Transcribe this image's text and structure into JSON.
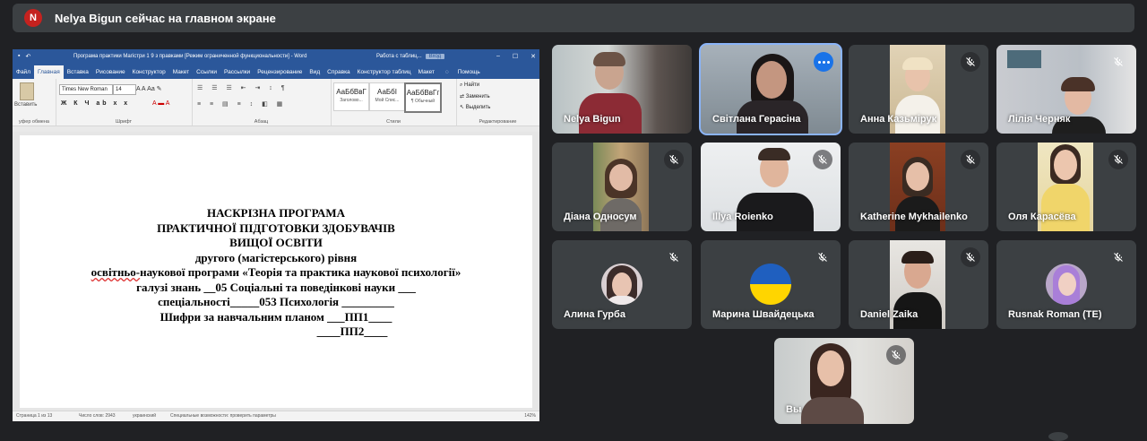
{
  "presenter_bar": {
    "avatar_letter": "N",
    "text": "Nelya Bigun сейчас на главном экране"
  },
  "shared_screen": {
    "title_bar": {
      "doc_title": "Програма практики Магістри 1 9 з правками [Режим ограниченной функциональности]  -  Word",
      "context_tab": "Работа с таблиц...",
      "signin": "Вход"
    },
    "tabs": [
      "Файл",
      "Главная",
      "Вставка",
      "Рисование",
      "Конструктор",
      "Макет",
      "Ссылки",
      "Рассылки",
      "Рецензирование",
      "Вид",
      "Справка",
      "Конструктор таблиц",
      "Макет",
      "Помощь"
    ],
    "ribbon": {
      "paste_label": "Вставить",
      "clipboard_label": "уфер обмена",
      "font_name": "Times New Roman",
      "font_size": "14",
      "font_group_label": "Шрифт",
      "paragraph_label": "Абзац",
      "styles_label": "Стили",
      "editing_label": "Редактирование",
      "styles": [
        {
          "sample": "АаБбВвГ",
          "name": "Заголово..."
        },
        {
          "sample": "АаБбI",
          "name": "Мой Спис..."
        },
        {
          "sample": "АаБбВвГг",
          "name": "¶ Обычный"
        }
      ],
      "find": "Найти",
      "replace": "Заменить",
      "select": "Выделить"
    },
    "document_lines": [
      "НАСКРІЗНА ПРОГРАМА",
      "ПРАКТИЧНОЇ ПІДГОТОВКИ ЗДОБУВАЧІВ",
      "ВИЩОЇ ОСВІТИ",
      "другого (магістерського) рівня",
      "наукової програми «Теорія та практика наукової психології»",
      "галузі знань __05 Соціальні та поведінкові науки ___",
      "спеціальності_____053 Психологія _________",
      "Шифри за навчальним планом ___ПП1____",
      "____ПП2____"
    ],
    "document_line5_prefix": "освітньо-",
    "status_bar": {
      "page": "Страница 1 из 13",
      "words": "Число слов: 2943",
      "language": "украинский",
      "accessibility": "Специальные возможности: проверить параметры",
      "zoom": "142%"
    }
  },
  "participants": [
    {
      "name": "Nelya Bigun",
      "muted": false
    },
    {
      "name": "Світлана Герасіна",
      "muted": false,
      "speaking": true
    },
    {
      "name": "Анна Казьмірук",
      "muted": true
    },
    {
      "name": "Лілія Черняк",
      "muted": true
    },
    {
      "name": "Діана Односум",
      "muted": true
    },
    {
      "name": "Illya Roienko",
      "muted": true
    },
    {
      "name": "Katherine Mykhailenko",
      "muted": true
    },
    {
      "name": "Оля Карасёва",
      "muted": true
    },
    {
      "name": "Алина Гурба",
      "muted": true
    },
    {
      "name": "Марина Швайдецька",
      "muted": true
    },
    {
      "name": "Daniel Zaika",
      "muted": true
    },
    {
      "name": "Rusnak Roman (TE)",
      "muted": true
    },
    {
      "name": "Вы",
      "muted": true
    }
  ],
  "colors": {
    "background": "#202124",
    "tile": "#3c4043",
    "active_outline": "#8ab4f8",
    "word_blue": "#2b579a",
    "presenter_avatar": "#c5221f"
  }
}
